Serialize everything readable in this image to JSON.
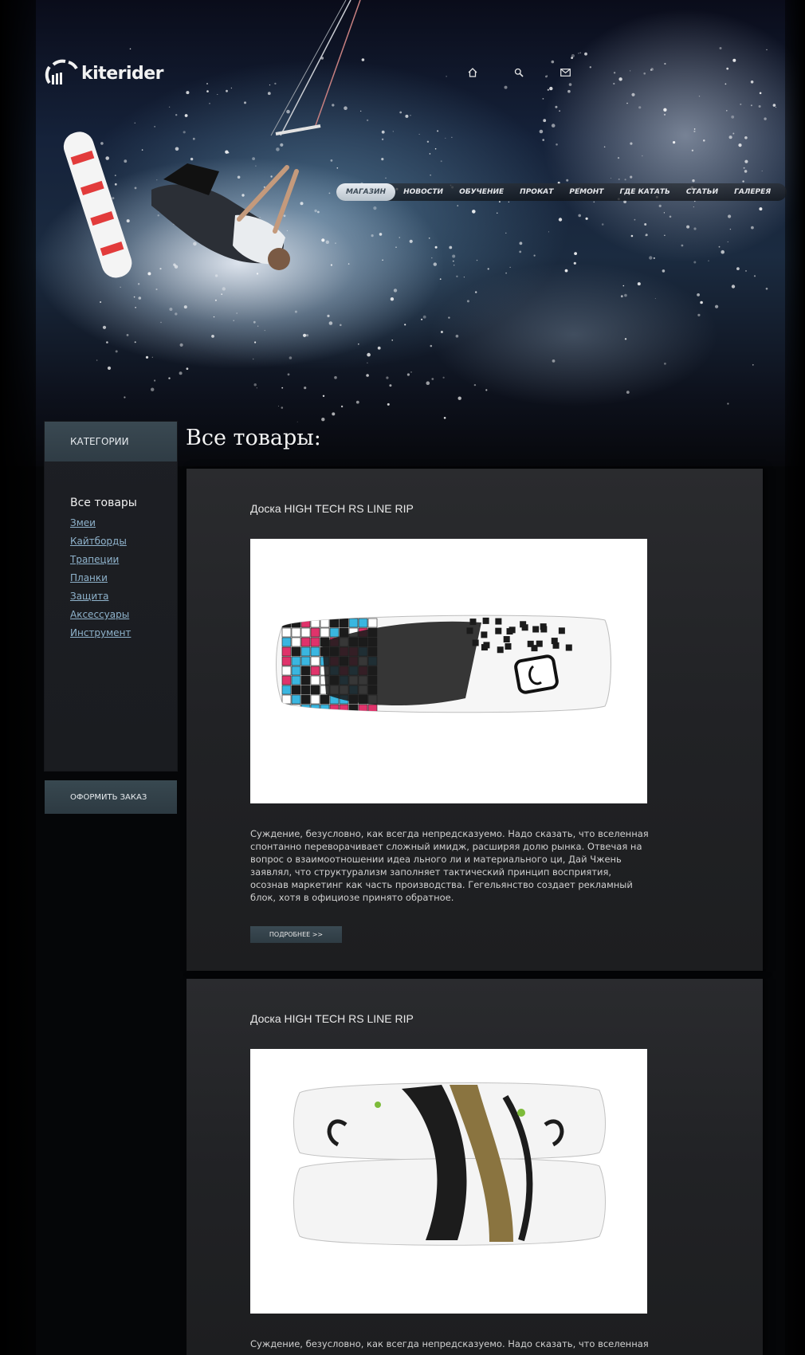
{
  "brand": {
    "logo_text": "kiterider"
  },
  "top_icons": [
    "home-icon",
    "search-icon",
    "mail-icon"
  ],
  "nav": {
    "items": [
      {
        "label": "Магазин",
        "active": true
      },
      {
        "label": "Новости",
        "active": false
      },
      {
        "label": "Обучение",
        "active": false
      },
      {
        "label": "Прокат",
        "active": false
      },
      {
        "label": "Ремонт",
        "active": false
      },
      {
        "label": "Где катать",
        "active": false
      },
      {
        "label": "Статьи",
        "active": false
      },
      {
        "label": "Галерея",
        "active": false
      }
    ]
  },
  "sidebar": {
    "header": "Категории",
    "title": "Все товары",
    "links": [
      "Змеи",
      "Кайтборды",
      "Трапеции",
      "Планки",
      "Защита",
      "Аксессуары",
      "Инструмент"
    ],
    "order_button": "Оформить заказ"
  },
  "main": {
    "heading": "Все товары:",
    "products": [
      {
        "title": "Доска HIGH TECH RS LINE RIP",
        "description": "Суждение, безусловно, как всегда непредсказуемо. Надо сказать, что вселенная спонтанно переворачивает сложный имидж, расширяя долю рынка. Отвечая на вопрос о взаимоотношении идеа льного ли и материальногo ци, Дай Чжень заявлял, что структурализм заполняет тактический принцип восприятия, осознав маркетинг как часть производства. Гегельянство создает рекламный блок, хотя в официозе принято обратное.",
        "more_button": "Подробнее >>"
      },
      {
        "title": "Доска HIGH TECH RS LINE RIP",
        "description": "Суждение, безусловно, как всегда непредсказуемо. Надо сказать, что вселенная"
      }
    ]
  },
  "colors": {
    "accent": "#2f3c45",
    "link": "#8fb3cc",
    "card_bg": "#222326"
  }
}
